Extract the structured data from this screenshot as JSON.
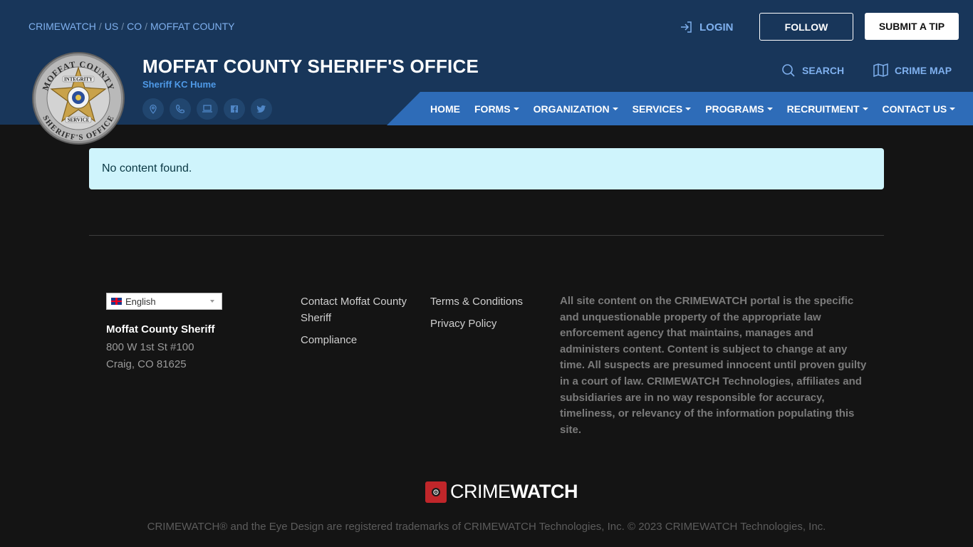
{
  "breadcrumb": [
    "CRIMEWATCH",
    "US",
    "CO",
    "MOFFAT COUNTY"
  ],
  "header": {
    "login_label": "LOGIN",
    "follow_label": "FOLLOW",
    "submit_tip_label": "SUBMIT A TIP",
    "agency_title": "MOFFAT COUNTY SHERIFF'S OFFICE",
    "sheriff_name": "Sheriff KC Hume",
    "search_label": "SEARCH",
    "crime_map_label": "CRIME MAP",
    "badge": {
      "top_text": "MOFFAT COUNTY",
      "bottom_text": "SHERIFF'S OFFICE",
      "ribbon_top": "INTEGRITY",
      "ribbon_bottom": "SERVICE"
    },
    "social_icons": [
      "location-icon",
      "phone-icon",
      "laptop-icon",
      "facebook-icon",
      "twitter-icon"
    ]
  },
  "nav": {
    "items": [
      {
        "label": "HOME",
        "dropdown": false
      },
      {
        "label": "FORMS",
        "dropdown": true
      },
      {
        "label": "ORGANIZATION",
        "dropdown": true
      },
      {
        "label": "SERVICES",
        "dropdown": true
      },
      {
        "label": "PROGRAMS",
        "dropdown": true
      },
      {
        "label": "RECRUITMENT",
        "dropdown": true
      },
      {
        "label": "CONTACT US",
        "dropdown": true
      }
    ]
  },
  "main": {
    "alert_text": "No content found."
  },
  "footer": {
    "language": "English",
    "org_name": "Moffat County Sheriff",
    "address_line1": "800 W 1st St #100",
    "address_line2": "Craig, CO 81625",
    "links_col1": [
      "Contact Moffat County Sheriff",
      "Compliance"
    ],
    "links_col2": [
      "Terms & Conditions",
      "Privacy Policy"
    ],
    "disclaimer": "All site content on the CRIMEWATCH portal is the specific and unquestionable property of the appropriate law enforcement agency that maintains, manages and administers content. Content is subject to change at any time. All suspects are presumed innocent until proven guilty in a court of law. CRIMEWATCH Technologies, affiliates and subsidiaries are in no way responsible for accuracy, timeliness, or relevancy of the information populating this site.",
    "logo_text_light": "CRIME",
    "logo_text_bold": "WATCH",
    "copyright": "CRIMEWATCH® and the Eye Design are registered trademarks of CRIMEWATCH Technologies, Inc. © 2023 CRIMEWATCH Technologies, Inc."
  },
  "colors": {
    "header_bg": "#18365a",
    "nav_bg": "#2e6cb8",
    "link_blue": "#7fb0ee",
    "alert_bg": "#cff4fc",
    "page_bg": "#141414",
    "crimewatch_red": "#c0262a"
  }
}
